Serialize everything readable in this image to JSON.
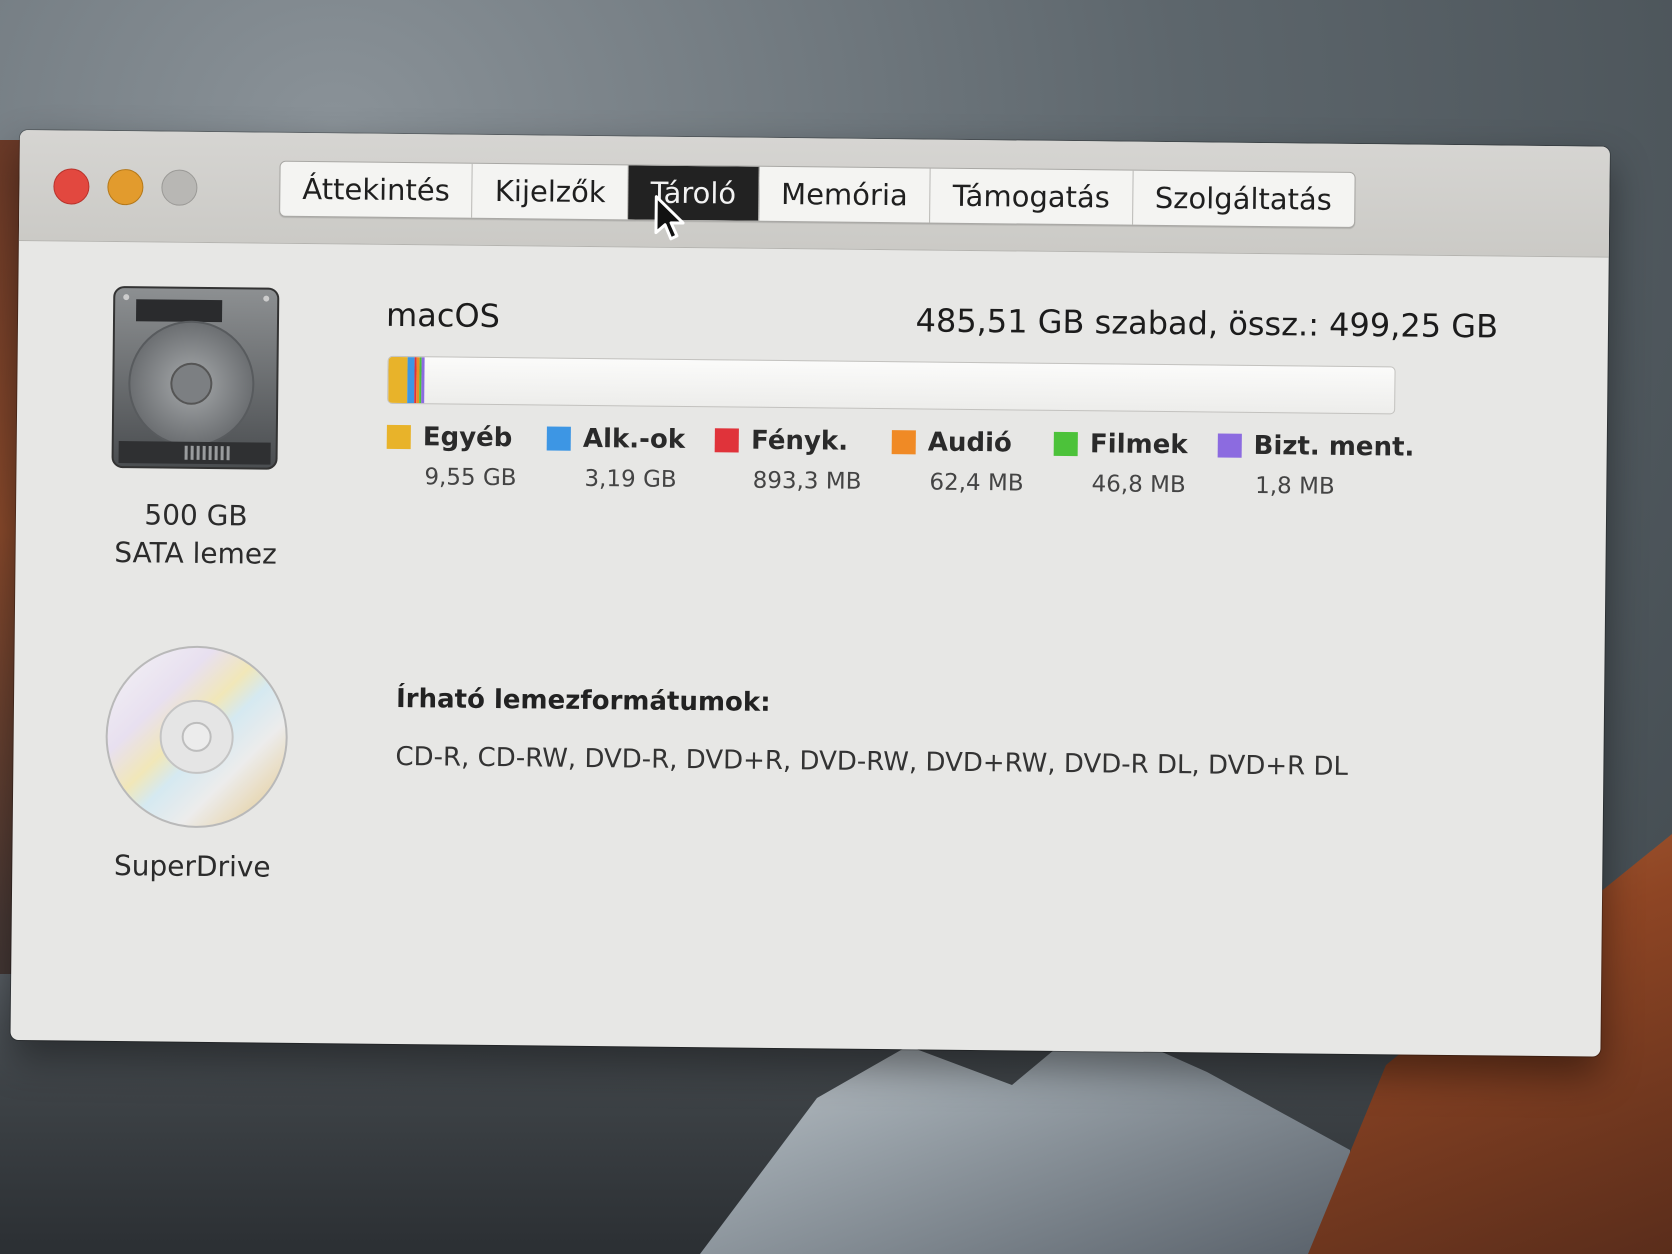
{
  "tabs": [
    {
      "label": "Áttekintés",
      "active": false
    },
    {
      "label": "Kijelzők",
      "active": false
    },
    {
      "label": "Tároló",
      "active": true
    },
    {
      "label": "Memória",
      "active": false
    },
    {
      "label": "Támogatás",
      "active": false
    },
    {
      "label": "Szolgáltatás",
      "active": false
    }
  ],
  "devices": {
    "hdd": {
      "icon": "hard-drive-icon",
      "capacity": "500 GB",
      "type": "SATA lemez"
    },
    "optical": {
      "icon": "optical-disc-icon",
      "name": "SuperDrive"
    }
  },
  "volume": {
    "name": "macOS",
    "summary": "485,51 GB szabad, össz.: 499,25 GB",
    "used_fraction": 0.0275
  },
  "legend": [
    {
      "label": "Egyéb",
      "size": "9,55 GB",
      "color": "#e8b32a"
    },
    {
      "label": "Alk.-ok",
      "size": "3,19 GB",
      "color": "#3d96e4"
    },
    {
      "label": "Fényk.",
      "size": "893,3 MB",
      "color": "#e0333a"
    },
    {
      "label": "Audió",
      "size": "62,4 MB",
      "color": "#f08a25"
    },
    {
      "label": "Filmek",
      "size": "46,8 MB",
      "color": "#4cc23a"
    },
    {
      "label": "Bizt. ment.",
      "size": "1,8 MB",
      "color": "#8c6be0"
    }
  ],
  "bar_segments": [
    {
      "name": "Egyéb",
      "fraction": 0.0191,
      "color": "#e8b32a"
    },
    {
      "name": "Alk.-ok",
      "fraction": 0.0064,
      "color": "#3d96e4"
    },
    {
      "name": "Fényk.",
      "fraction": 0.0018,
      "color": "#e0333a"
    },
    {
      "name": "Audió",
      "fraction": 0.0006,
      "color": "#f08a25"
    },
    {
      "name": "Filmek",
      "fraction": 0.0005,
      "color": "#4cc23a"
    },
    {
      "name": "Bizt. ment.",
      "fraction": 0.0002,
      "color": "#8c6be0"
    }
  ],
  "formats": {
    "title": "Írható lemezformátumok:",
    "list": "CD-R, CD-RW, DVD-R, DVD+R, DVD-RW, DVD+RW, DVD-R DL, DVD+R DL"
  }
}
